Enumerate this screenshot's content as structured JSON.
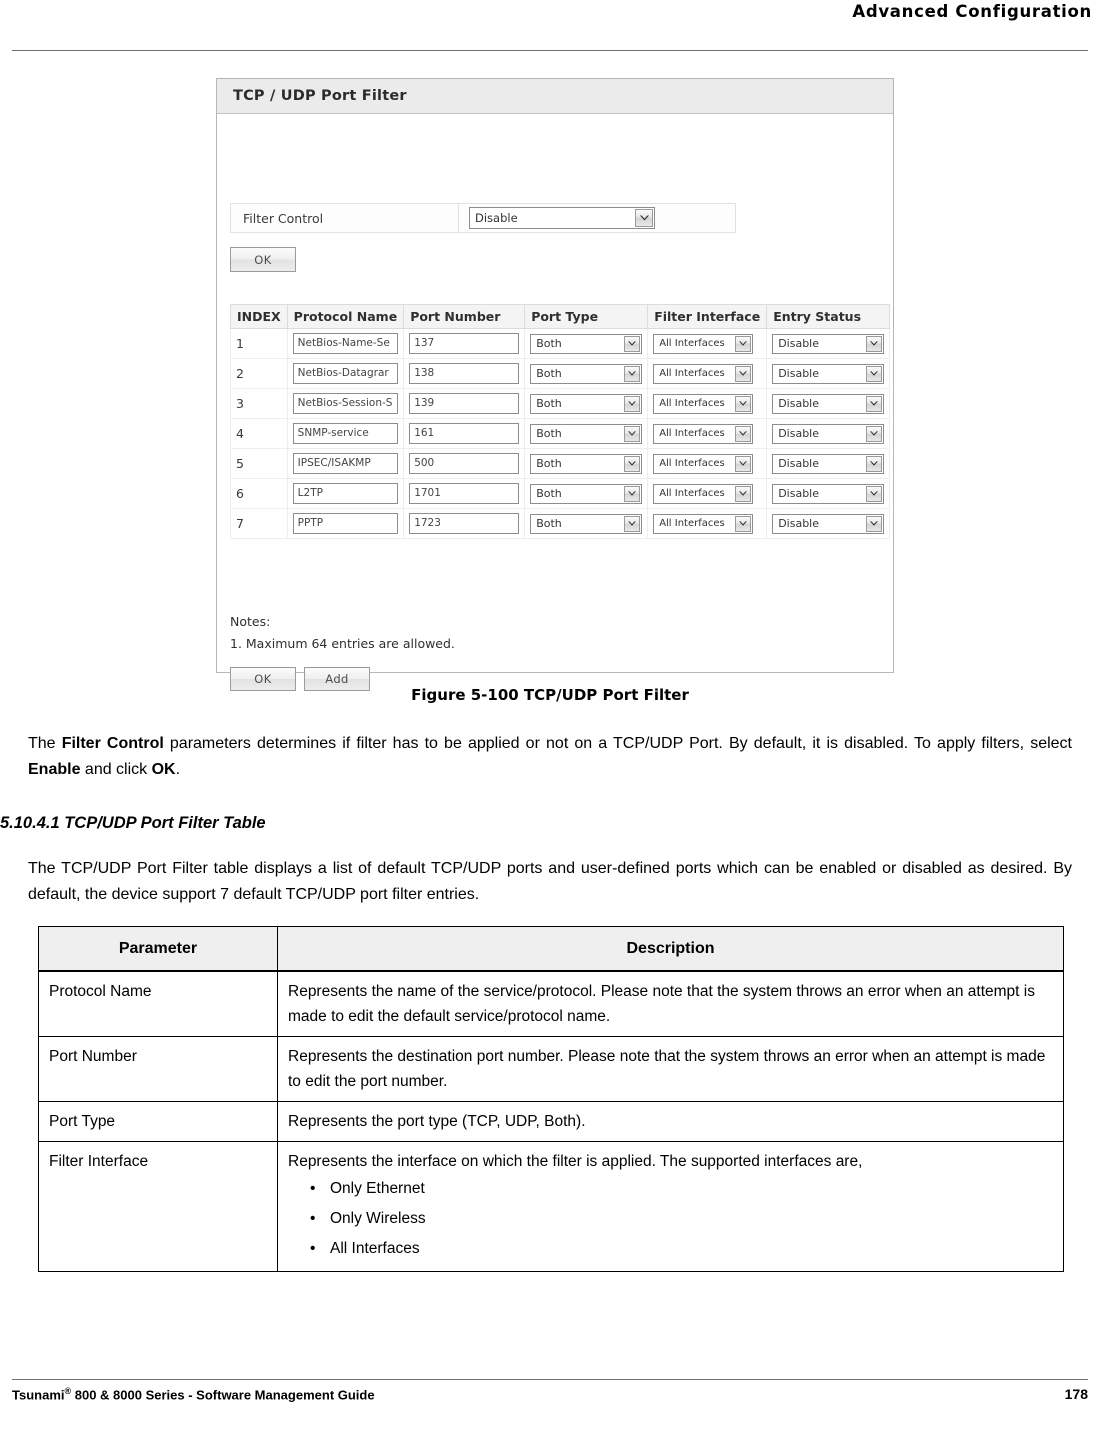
{
  "page": {
    "header_title": "Advanced Configuration",
    "footer_left_pre": "Tsunami",
    "footer_left_sup": "®",
    "footer_left_post": " 800 & 8000 Series - Software Management Guide",
    "page_number": "178"
  },
  "figure": {
    "caption": "Figure 5-100 TCP/UDP Port Filter",
    "panel_title": "TCP / UDP Port Filter",
    "filter_control": {
      "label": "Filter Control",
      "value": "Disable"
    },
    "ok_top_label": "OK",
    "table": {
      "headers": [
        "INDEX",
        "Protocol Name",
        "Port Number",
        "Port Type",
        "Filter Interface",
        "Entry Status"
      ],
      "rows": [
        {
          "index": "1",
          "protocol": "NetBios-Name-Se",
          "port": "137",
          "type": "Both",
          "iface": "All Interfaces",
          "status": "Disable"
        },
        {
          "index": "2",
          "protocol": "NetBios-Datagrar",
          "port": "138",
          "type": "Both",
          "iface": "All Interfaces",
          "status": "Disable"
        },
        {
          "index": "3",
          "protocol": "NetBios-Session-S",
          "port": "139",
          "type": "Both",
          "iface": "All Interfaces",
          "status": "Disable"
        },
        {
          "index": "4",
          "protocol": "SNMP-service",
          "port": "161",
          "type": "Both",
          "iface": "All Interfaces",
          "status": "Disable"
        },
        {
          "index": "5",
          "protocol": "IPSEC/ISAKMP",
          "port": "500",
          "type": "Both",
          "iface": "All Interfaces",
          "status": "Disable"
        },
        {
          "index": "6",
          "protocol": "L2TP",
          "port": "1701",
          "type": "Both",
          "iface": "All Interfaces",
          "status": "Disable"
        },
        {
          "index": "7",
          "protocol": "PPTP",
          "port": "1723",
          "type": "Both",
          "iface": "All Interfaces",
          "status": "Disable"
        }
      ]
    },
    "notes_title": "Notes:",
    "notes_item": "1. Maximum 64 entries are allowed.",
    "ok_bottom_label": "OK",
    "add_label": "Add"
  },
  "content": {
    "paragraph_1_part1": "The ",
    "paragraph_1_bold1": "Filter Control",
    "paragraph_1_part2": " parameters determines if filter has to be applied or not on a TCP/UDP Port. By default, it is disabled. To apply filters, select ",
    "paragraph_1_bold2": "Enable",
    "paragraph_1_part3": " and click ",
    "paragraph_1_bold3": "OK",
    "paragraph_1_part4": ".",
    "section_heading": "5.10.4.1 TCP/UDP Port Filter Table",
    "paragraph_2": "The TCP/UDP Port Filter table displays a list of default TCP/UDP ports and user-defined ports which can be enabled or disabled as desired. By default, the device support 7 default TCP/UDP port filter entries."
  },
  "param_table": {
    "headers": [
      "Parameter",
      "Description"
    ],
    "rows": [
      {
        "parameter": "Protocol Name",
        "description": "Represents the name of the service/protocol. Please note that the system throws an error when an attempt is made to edit the default service/protocol name."
      },
      {
        "parameter": "Port Number",
        "description": "Represents the destination port number. Please note that the system throws an error when an attempt is made to edit the port number."
      },
      {
        "parameter": "Port Type",
        "description": "Represents the port type (TCP, UDP, Both)."
      },
      {
        "parameter": "Filter Interface",
        "description": "Represents the interface on which the filter is applied. The supported interfaces are,",
        "bullets": [
          "Only Ethernet",
          "Only Wireless",
          "All Interfaces"
        ]
      }
    ]
  }
}
